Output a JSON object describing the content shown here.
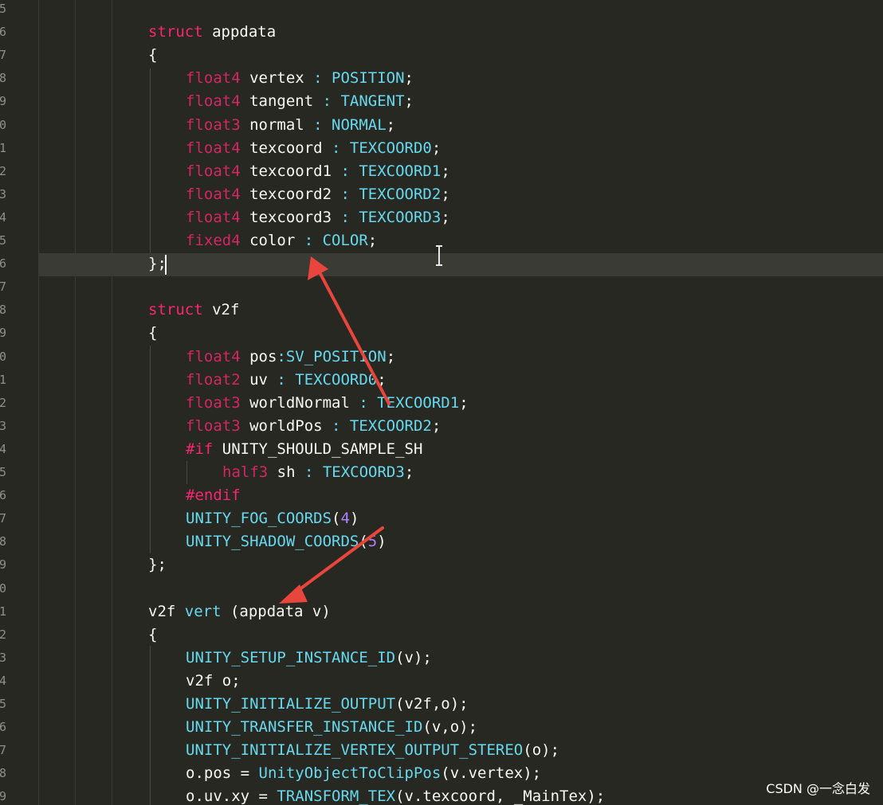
{
  "code_lines": [
    {
      "n": "5",
      "tokens": []
    },
    {
      "n": "6",
      "tokens": [
        [
          "kw",
          "struct"
        ],
        [
          "pl",
          " appdata"
        ]
      ]
    },
    {
      "n": "7",
      "tokens": [
        [
          "pl",
          "{"
        ]
      ]
    },
    {
      "n": "8",
      "tokens": [
        [
          "ty",
          "float4"
        ],
        [
          "pl",
          " vertex "
        ],
        [
          "fn",
          ": POSITION"
        ],
        [
          "pl",
          ";"
        ]
      ]
    },
    {
      "n": "9",
      "tokens": [
        [
          "ty",
          "float4"
        ],
        [
          "pl",
          " tangent "
        ],
        [
          "fn",
          ": TANGENT"
        ],
        [
          "pl",
          ";"
        ]
      ]
    },
    {
      "n": "0",
      "tokens": [
        [
          "ty",
          "float3"
        ],
        [
          "pl",
          " normal "
        ],
        [
          "fn",
          ": NORMAL"
        ],
        [
          "pl",
          ";"
        ]
      ]
    },
    {
      "n": "1",
      "tokens": [
        [
          "ty",
          "float4"
        ],
        [
          "pl",
          " texcoord "
        ],
        [
          "fn",
          ": TEXCOORD0"
        ],
        [
          "pl",
          ";"
        ]
      ]
    },
    {
      "n": "2",
      "tokens": [
        [
          "ty",
          "float4"
        ],
        [
          "pl",
          " texcoord1 "
        ],
        [
          "fn",
          ": TEXCOORD1"
        ],
        [
          "pl",
          ";"
        ]
      ]
    },
    {
      "n": "3",
      "tokens": [
        [
          "ty",
          "float4"
        ],
        [
          "pl",
          " texcoord2 "
        ],
        [
          "fn",
          ": TEXCOORD2"
        ],
        [
          "pl",
          ";"
        ]
      ]
    },
    {
      "n": "4",
      "tokens": [
        [
          "ty",
          "float4"
        ],
        [
          "pl",
          " texcoord3 "
        ],
        [
          "fn",
          ": TEXCOORD3"
        ],
        [
          "pl",
          ";"
        ]
      ]
    },
    {
      "n": "5",
      "tokens": [
        [
          "ty",
          "fixed4"
        ],
        [
          "pl",
          " color "
        ],
        [
          "fn",
          ": COLOR"
        ],
        [
          "pl",
          ";"
        ]
      ]
    },
    {
      "n": "6",
      "tokens": [
        [
          "pl",
          "};"
        ]
      ]
    },
    {
      "n": "7",
      "tokens": []
    },
    {
      "n": "8",
      "tokens": [
        [
          "kw",
          "struct"
        ],
        [
          "pl",
          " v2f"
        ]
      ]
    },
    {
      "n": "9",
      "tokens": [
        [
          "pl",
          "{"
        ]
      ]
    },
    {
      "n": "0",
      "tokens": [
        [
          "ty",
          "float4"
        ],
        [
          "pl",
          " pos"
        ],
        [
          "fn",
          ":SV_POSITION"
        ],
        [
          "pl",
          ";"
        ]
      ]
    },
    {
      "n": "1",
      "tokens": [
        [
          "ty",
          "float2"
        ],
        [
          "pl",
          " uv "
        ],
        [
          "fn",
          ": TEXCOORD0"
        ],
        [
          "pl",
          ";"
        ]
      ]
    },
    {
      "n": "2",
      "tokens": [
        [
          "ty",
          "float3"
        ],
        [
          "pl",
          " worldNormal "
        ],
        [
          "fn",
          ": TEXCOORD1"
        ],
        [
          "pl",
          ";"
        ]
      ]
    },
    {
      "n": "3",
      "tokens": [
        [
          "ty",
          "float3"
        ],
        [
          "pl",
          " worldPos "
        ],
        [
          "fn",
          ": TEXCOORD2"
        ],
        [
          "pl",
          ";"
        ]
      ]
    },
    {
      "n": "4",
      "tokens": [
        [
          "kw",
          "#if"
        ],
        [
          "pl",
          " UNITY_SHOULD_SAMPLE_SH"
        ]
      ]
    },
    {
      "n": "5",
      "tokens": [
        [
          "ty",
          "half3"
        ],
        [
          "pl",
          " sh "
        ],
        [
          "fn",
          ": TEXCOORD3"
        ],
        [
          "pl",
          ";"
        ]
      ]
    },
    {
      "n": "6",
      "tokens": [
        [
          "kw",
          "#endif"
        ]
      ]
    },
    {
      "n": "7",
      "tokens": [
        [
          "fn",
          "UNITY_FOG_COORDS"
        ],
        [
          "pl",
          "("
        ],
        [
          "num",
          "4"
        ],
        [
          "pl",
          ")"
        ]
      ]
    },
    {
      "n": "8",
      "tokens": [
        [
          "fn",
          "UNITY_SHADOW_COORDS"
        ],
        [
          "pl",
          "("
        ],
        [
          "num",
          "5"
        ],
        [
          "pl",
          ")"
        ]
      ]
    },
    {
      "n": "9",
      "tokens": [
        [
          "pl",
          "};"
        ]
      ]
    },
    {
      "n": "0",
      "tokens": []
    },
    {
      "n": "1",
      "tokens": [
        [
          "pl",
          "v2f "
        ],
        [
          "fn",
          "vert"
        ],
        [
          "pl",
          " (appdata v)"
        ]
      ]
    },
    {
      "n": "2",
      "tokens": [
        [
          "pl",
          "{"
        ]
      ]
    },
    {
      "n": "3",
      "tokens": [
        [
          "fn",
          "UNITY_SETUP_INSTANCE_ID"
        ],
        [
          "pl",
          "(v);"
        ]
      ]
    },
    {
      "n": "4",
      "tokens": [
        [
          "pl",
          "v2f o;"
        ]
      ]
    },
    {
      "n": "5",
      "tokens": [
        [
          "fn",
          "UNITY_INITIALIZE_OUTPUT"
        ],
        [
          "pl",
          "(v2f,o);"
        ]
      ]
    },
    {
      "n": "6",
      "tokens": [
        [
          "fn",
          "UNITY_TRANSFER_INSTANCE_ID"
        ],
        [
          "pl",
          "(v,o);"
        ]
      ]
    },
    {
      "n": "7",
      "tokens": [
        [
          "fn",
          "UNITY_INITIALIZE_VERTEX_OUTPUT_STEREO"
        ],
        [
          "pl",
          "(o);"
        ]
      ]
    },
    {
      "n": "8",
      "tokens": [
        [
          "pl",
          "o.pos = "
        ],
        [
          "fn",
          "UnityObjectToClipPos"
        ],
        [
          "pl",
          "(v.vertex);"
        ]
      ]
    },
    {
      "n": "9",
      "tokens": [
        [
          "pl",
          "o.uv.xy = "
        ],
        [
          "fn",
          "TRANSFORM_TEX"
        ],
        [
          "pl",
          "(v.texcoord, _MainTex);"
        ]
      ]
    }
  ],
  "watermark": "CSDN @一念白发",
  "colors": {
    "background": "#272822",
    "keyword": "#f92672",
    "function": "#66d9ef",
    "number": "#ae81ff",
    "plain": "#f8f8f2",
    "annotation_arrow": "#e8453c"
  },
  "icons": [
    "text-cursor-icon",
    "annotation-arrow"
  ]
}
